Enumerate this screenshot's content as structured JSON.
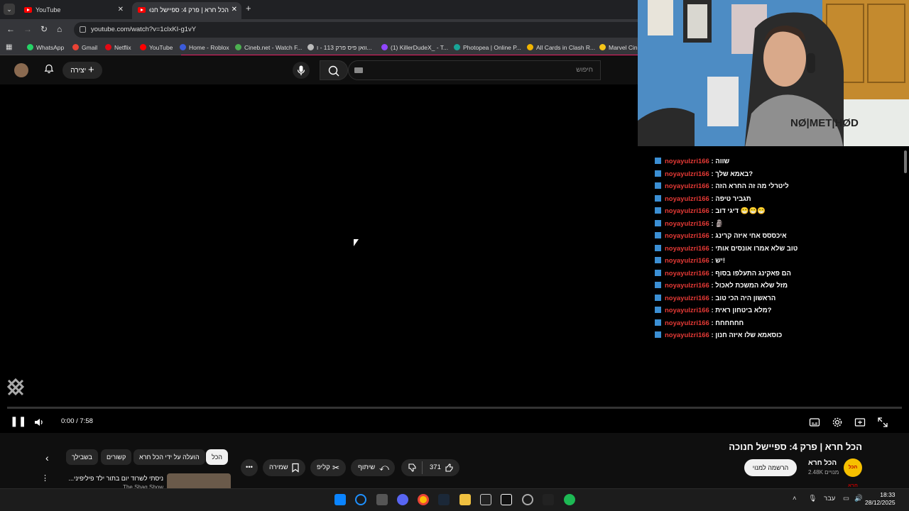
{
  "browser": {
    "tabs": [
      {
        "label": "YouTube"
      },
      {
        "label": "הכל חרא | פרק 4: ספיישל חנוכה"
      }
    ],
    "url": "youtube.com/watch?v=1clxKI-g1vY",
    "bookmarks": [
      {
        "label": "WhatsApp",
        "color": "#25d366"
      },
      {
        "label": "Gmail",
        "color": "#ea4335"
      },
      {
        "label": "Netflix",
        "color": "#e50914"
      },
      {
        "label": "YouTube",
        "color": "#ff0000"
      },
      {
        "label": "Home - Roblox",
        "color": "#3b5bdb"
      },
      {
        "label": "Cineb.net - Watch F...",
        "color": "#4caf50"
      },
      {
        "label": "וואן פיס פרק 113 - ו...",
        "color": "#bbbbbb"
      },
      {
        "label": "(1) KillerDudeX_ - T...",
        "color": "#9146ff"
      },
      {
        "label": "Photopea | Online P...",
        "color": "#18a497"
      },
      {
        "label": "All Cards in Clash R...",
        "color": "#f0b400"
      },
      {
        "label": "Marvel Cine",
        "color": "#f5c518"
      }
    ]
  },
  "youtube": {
    "create_label": "יצירה",
    "search_placeholder": "חיפוש",
    "player": {
      "time": "0:00 / 7:58",
      "progress": 0.0
    },
    "video_title": "הכל חרא | פרק 4: ספיישל חנוכה",
    "channel": {
      "name": "הכל חרא",
      "subscribers": "2.48K מנויים",
      "avatar_text": "הכל חרא"
    },
    "subscribe_label": "הרשמה למנוי",
    "likes": "371",
    "share_label": "שיתוף",
    "clip_label": "קליפ",
    "save_label": "שמירה",
    "chips": [
      {
        "label": "הכל",
        "selected": true
      },
      {
        "label": "הועלה על ידי הכל חרא",
        "selected": false
      },
      {
        "label": "קשורים",
        "selected": false
      },
      {
        "label": "בשבילך",
        "selected": false
      }
    ],
    "recommendation": {
      "title": "ניסתי לשרוד יום בתור ילד פיליפיני...",
      "channel": "The Shaq Show"
    }
  },
  "chat": [
    {
      "user": "noyayulzri166",
      "msg": "שווה"
    },
    {
      "user": "noyayulzri166",
      "msg": "באמא שלך?"
    },
    {
      "user": "noyayulzri166",
      "msg": "ליטרלי מה זה החרא הזה"
    },
    {
      "user": "noyayulzri166",
      "msg": "תגביר טיפה"
    },
    {
      "user": "noyayulzri166",
      "msg": "דיגי דוב 😁😁😁"
    },
    {
      "user": "noyayulzri166",
      "msg": "🗿"
    },
    {
      "user": "noyayulzri166",
      "msg": "איכססס אחי איזה קרינג"
    },
    {
      "user": "noyayulzri166",
      "msg": "טוב שלא אמרו אונסים אותי"
    },
    {
      "user": "noyayulzri166",
      "msg": "יש!"
    },
    {
      "user": "noyayulzri166",
      "msg": "הם פאקינג התעלפו בסוף"
    },
    {
      "user": "noyayulzri166",
      "msg": "מזל שלא המשכת לאכול"
    },
    {
      "user": "noyayulzri166",
      "msg": "הראשון היה הכי טוב"
    },
    {
      "user": "noyayulzri166",
      "msg": "מלא ביטחון ראית?"
    },
    {
      "user": "noyayulzri166",
      "msg": "חחחחחח"
    },
    {
      "user": "noyayulzri166",
      "msg": "כוסאמא שלו איזה חנון"
    }
  ],
  "webcam": {
    "shirt_text": "NØ|MET|HØD"
  },
  "taskbar": {
    "time": "18:33",
    "date": "28/12/2025",
    "lang": "עבר"
  }
}
